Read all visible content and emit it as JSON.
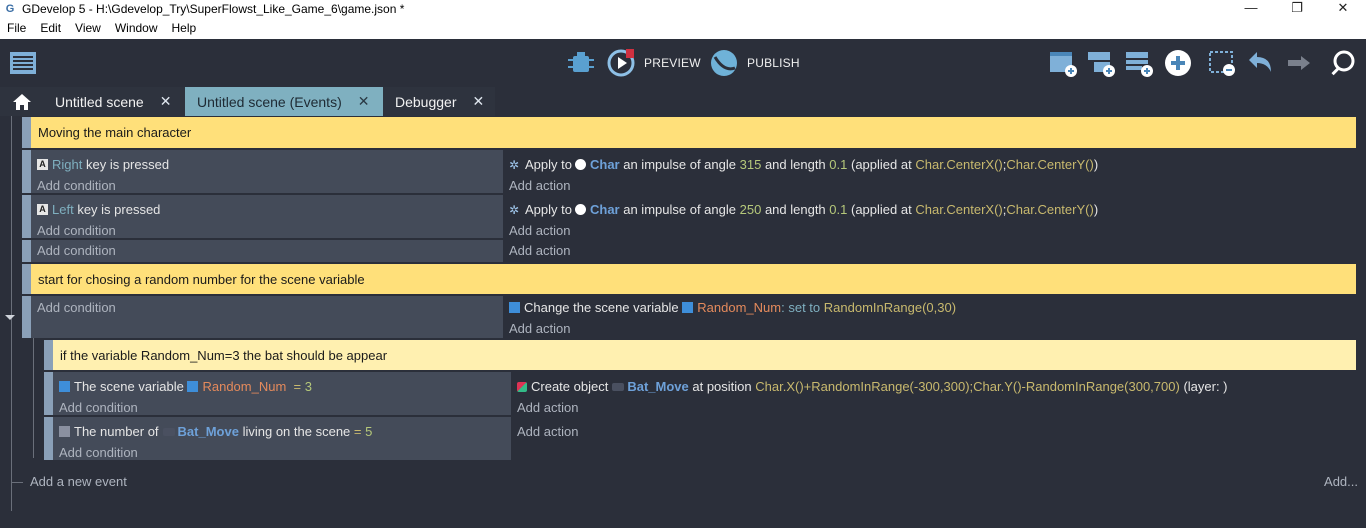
{
  "window": {
    "title": "GDevelop 5 - H:\\Gdevelop_Try\\SuperFlowst_Like_Game_6\\game.json *",
    "minimize": "—",
    "maximize": "❐",
    "close": "✕"
  },
  "menu": [
    "File",
    "Edit",
    "View",
    "Window",
    "Help"
  ],
  "toolbar": {
    "preview_label": "PREVIEW",
    "publish_label": "PUBLISH"
  },
  "tabs": [
    {
      "label": "Untitled scene",
      "close": "✕"
    },
    {
      "label": "Untitled scene (Events)",
      "close": "✕"
    },
    {
      "label": "Debugger",
      "close": "✕"
    }
  ],
  "events": {
    "comment1": "Moving the main character",
    "e1": {
      "key": "Right",
      "cond_text": "key is pressed",
      "act_apply": "Apply to",
      "act_obj": "Char",
      "act_mid": "an impulse of angle",
      "angle": "315",
      "act_len": "and length",
      "length": "0.1",
      "act_at": "(applied at",
      "cx": "Char.CenterX()",
      "sep": ";",
      "cy": "Char.CenterY()",
      "close": ")"
    },
    "e2": {
      "key": "Left",
      "cond_text": "key is pressed",
      "act_apply": "Apply to",
      "act_obj": "Char",
      "act_mid": "an impulse of angle",
      "angle": "250",
      "act_len": "and length",
      "length": "0.1",
      "act_at": "(applied at",
      "cx": "Char.CenterX()",
      "sep": ";",
      "cy": "Char.CenterY()",
      "close": ")"
    },
    "comment2": "start for chosing a random number for the scene variable",
    "e4": {
      "act_text": "Change the scene variable",
      "var": "Random_Num",
      "setto": ": set to",
      "expr": "RandomInRange(0,30)"
    },
    "comment3": "if the variable Random_Num=3 the bat should be appear",
    "e5": {
      "cond_text": "The scene variable",
      "var": "Random_Num",
      "op": "=",
      "val": "3",
      "act_text": "Create object",
      "obj": "Bat_Move",
      "at": "at position",
      "pos": "Char.X()+RandomInRange(-300,300);Char.Y()-RandomInRange(300,700)",
      "layer": "(layer: )"
    },
    "e6": {
      "cond_text": "The number of",
      "obj": "Bat_Move",
      "living": "living on the scene",
      "op": "=",
      "val": "5"
    },
    "add_condition": "Add condition",
    "add_action": "Add action",
    "add_event": "Add a new event",
    "add_more": "Add..."
  }
}
